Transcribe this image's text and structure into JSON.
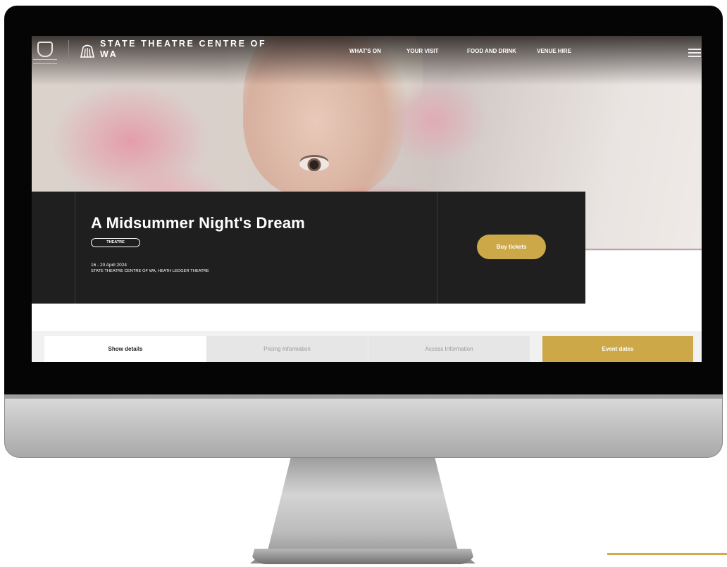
{
  "brand": {
    "name": "STATE THEATRE CENTRE OF WA"
  },
  "nav": {
    "items": [
      "WHAT'S ON",
      "YOUR VISIT",
      "FOOD AND DRINK",
      "VENUE HIRE"
    ]
  },
  "event": {
    "title": "A Midsummer Night's Dream",
    "tag": "THEATRE",
    "dates": "16 - 20 April 2024",
    "venue": "STATE THEATRE CENTRE OF WA, HEATH LEDGER THEATRE",
    "buy_label": "Buy tickets"
  },
  "tabs": {
    "show_details": "Show details",
    "pricing": "Pricing Information",
    "access": "Access Information",
    "event_dates": "Event dates"
  },
  "colors": {
    "accent": "#cda849",
    "card": "#1f1f1f",
    "bezel": "#050505"
  },
  "icons": [
    "government-crest-icon",
    "theatre-logo-icon",
    "hamburger-menu-icon"
  ]
}
